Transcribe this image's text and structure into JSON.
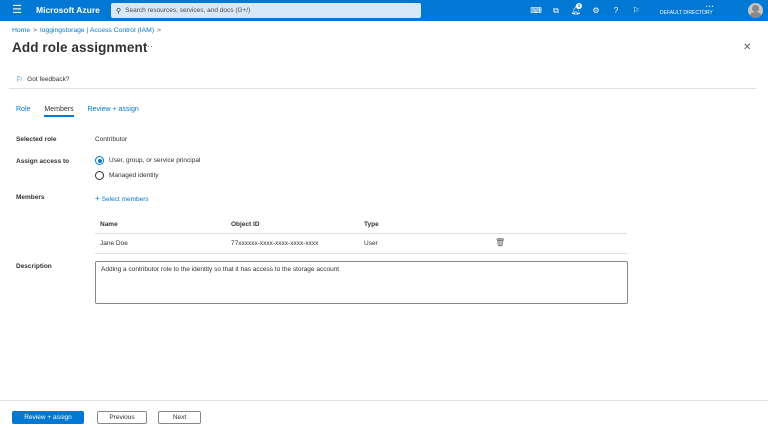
{
  "topbar": {
    "brand": "Microsoft Azure",
    "search_placeholder": "Search resources, services, and docs (G+/)",
    "notification_count": "1",
    "account_dots": "• • •",
    "directory": "DEFAULT DIRECTORY"
  },
  "breadcrumb": {
    "home": "Home",
    "resource": "loggingstorage | Access Control (IAM)"
  },
  "page": {
    "title": "Add role assignment",
    "more": "···",
    "close": "✕",
    "feedback": "Got feedback?"
  },
  "tabs": [
    "Role",
    "Members",
    "Review + assign"
  ],
  "form": {
    "selected_role_label": "Selected role",
    "selected_role_value": "Contributor",
    "assign_access_label": "Assign access to",
    "assign_options": [
      "User, group, or service principal",
      "Managed identity"
    ],
    "members_label": "Members",
    "select_members": "Select members",
    "description_label": "Description",
    "description_value": "Adding a contributor role to the identity so that it has access to the storage account"
  },
  "members_table": {
    "headers": [
      "Name",
      "Object ID",
      "Type"
    ],
    "rows": [
      {
        "name": "Jane Doe",
        "object_id": "77xxxxxx-xxxx-xxxx-xxxx-xxxx",
        "type": "User"
      }
    ]
  },
  "footer": {
    "review_assign": "Review + assign",
    "previous": "Previous",
    "next": "Next"
  },
  "colors": {
    "accent": "#0078d4",
    "text": "#323130"
  }
}
